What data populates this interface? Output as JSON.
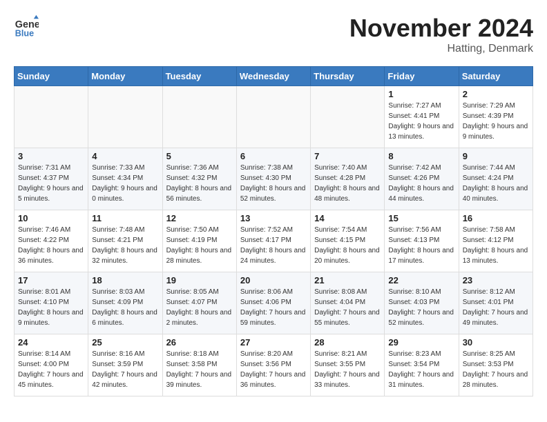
{
  "header": {
    "logo_line1": "General",
    "logo_line2": "Blue",
    "month": "November 2024",
    "location": "Hatting, Denmark"
  },
  "weekdays": [
    "Sunday",
    "Monday",
    "Tuesday",
    "Wednesday",
    "Thursday",
    "Friday",
    "Saturday"
  ],
  "weeks": [
    [
      {
        "day": "",
        "sunrise": "",
        "sunset": "",
        "daylight": ""
      },
      {
        "day": "",
        "sunrise": "",
        "sunset": "",
        "daylight": ""
      },
      {
        "day": "",
        "sunrise": "",
        "sunset": "",
        "daylight": ""
      },
      {
        "day": "",
        "sunrise": "",
        "sunset": "",
        "daylight": ""
      },
      {
        "day": "",
        "sunrise": "",
        "sunset": "",
        "daylight": ""
      },
      {
        "day": "1",
        "sunrise": "Sunrise: 7:27 AM",
        "sunset": "Sunset: 4:41 PM",
        "daylight": "Daylight: 9 hours and 13 minutes."
      },
      {
        "day": "2",
        "sunrise": "Sunrise: 7:29 AM",
        "sunset": "Sunset: 4:39 PM",
        "daylight": "Daylight: 9 hours and 9 minutes."
      }
    ],
    [
      {
        "day": "3",
        "sunrise": "Sunrise: 7:31 AM",
        "sunset": "Sunset: 4:37 PM",
        "daylight": "Daylight: 9 hours and 5 minutes."
      },
      {
        "day": "4",
        "sunrise": "Sunrise: 7:33 AM",
        "sunset": "Sunset: 4:34 PM",
        "daylight": "Daylight: 9 hours and 0 minutes."
      },
      {
        "day": "5",
        "sunrise": "Sunrise: 7:36 AM",
        "sunset": "Sunset: 4:32 PM",
        "daylight": "Daylight: 8 hours and 56 minutes."
      },
      {
        "day": "6",
        "sunrise": "Sunrise: 7:38 AM",
        "sunset": "Sunset: 4:30 PM",
        "daylight": "Daylight: 8 hours and 52 minutes."
      },
      {
        "day": "7",
        "sunrise": "Sunrise: 7:40 AM",
        "sunset": "Sunset: 4:28 PM",
        "daylight": "Daylight: 8 hours and 48 minutes."
      },
      {
        "day": "8",
        "sunrise": "Sunrise: 7:42 AM",
        "sunset": "Sunset: 4:26 PM",
        "daylight": "Daylight: 8 hours and 44 minutes."
      },
      {
        "day": "9",
        "sunrise": "Sunrise: 7:44 AM",
        "sunset": "Sunset: 4:24 PM",
        "daylight": "Daylight: 8 hours and 40 minutes."
      }
    ],
    [
      {
        "day": "10",
        "sunrise": "Sunrise: 7:46 AM",
        "sunset": "Sunset: 4:22 PM",
        "daylight": "Daylight: 8 hours and 36 minutes."
      },
      {
        "day": "11",
        "sunrise": "Sunrise: 7:48 AM",
        "sunset": "Sunset: 4:21 PM",
        "daylight": "Daylight: 8 hours and 32 minutes."
      },
      {
        "day": "12",
        "sunrise": "Sunrise: 7:50 AM",
        "sunset": "Sunset: 4:19 PM",
        "daylight": "Daylight: 8 hours and 28 minutes."
      },
      {
        "day": "13",
        "sunrise": "Sunrise: 7:52 AM",
        "sunset": "Sunset: 4:17 PM",
        "daylight": "Daylight: 8 hours and 24 minutes."
      },
      {
        "day": "14",
        "sunrise": "Sunrise: 7:54 AM",
        "sunset": "Sunset: 4:15 PM",
        "daylight": "Daylight: 8 hours and 20 minutes."
      },
      {
        "day": "15",
        "sunrise": "Sunrise: 7:56 AM",
        "sunset": "Sunset: 4:13 PM",
        "daylight": "Daylight: 8 hours and 17 minutes."
      },
      {
        "day": "16",
        "sunrise": "Sunrise: 7:58 AM",
        "sunset": "Sunset: 4:12 PM",
        "daylight": "Daylight: 8 hours and 13 minutes."
      }
    ],
    [
      {
        "day": "17",
        "sunrise": "Sunrise: 8:01 AM",
        "sunset": "Sunset: 4:10 PM",
        "daylight": "Daylight: 8 hours and 9 minutes."
      },
      {
        "day": "18",
        "sunrise": "Sunrise: 8:03 AM",
        "sunset": "Sunset: 4:09 PM",
        "daylight": "Daylight: 8 hours and 6 minutes."
      },
      {
        "day": "19",
        "sunrise": "Sunrise: 8:05 AM",
        "sunset": "Sunset: 4:07 PM",
        "daylight": "Daylight: 8 hours and 2 minutes."
      },
      {
        "day": "20",
        "sunrise": "Sunrise: 8:06 AM",
        "sunset": "Sunset: 4:06 PM",
        "daylight": "Daylight: 7 hours and 59 minutes."
      },
      {
        "day": "21",
        "sunrise": "Sunrise: 8:08 AM",
        "sunset": "Sunset: 4:04 PM",
        "daylight": "Daylight: 7 hours and 55 minutes."
      },
      {
        "day": "22",
        "sunrise": "Sunrise: 8:10 AM",
        "sunset": "Sunset: 4:03 PM",
        "daylight": "Daylight: 7 hours and 52 minutes."
      },
      {
        "day": "23",
        "sunrise": "Sunrise: 8:12 AM",
        "sunset": "Sunset: 4:01 PM",
        "daylight": "Daylight: 7 hours and 49 minutes."
      }
    ],
    [
      {
        "day": "24",
        "sunrise": "Sunrise: 8:14 AM",
        "sunset": "Sunset: 4:00 PM",
        "daylight": "Daylight: 7 hours and 45 minutes."
      },
      {
        "day": "25",
        "sunrise": "Sunrise: 8:16 AM",
        "sunset": "Sunset: 3:59 PM",
        "daylight": "Daylight: 7 hours and 42 minutes."
      },
      {
        "day": "26",
        "sunrise": "Sunrise: 8:18 AM",
        "sunset": "Sunset: 3:58 PM",
        "daylight": "Daylight: 7 hours and 39 minutes."
      },
      {
        "day": "27",
        "sunrise": "Sunrise: 8:20 AM",
        "sunset": "Sunset: 3:56 PM",
        "daylight": "Daylight: 7 hours and 36 minutes."
      },
      {
        "day": "28",
        "sunrise": "Sunrise: 8:21 AM",
        "sunset": "Sunset: 3:55 PM",
        "daylight": "Daylight: 7 hours and 33 minutes."
      },
      {
        "day": "29",
        "sunrise": "Sunrise: 8:23 AM",
        "sunset": "Sunset: 3:54 PM",
        "daylight": "Daylight: 7 hours and 31 minutes."
      },
      {
        "day": "30",
        "sunrise": "Sunrise: 8:25 AM",
        "sunset": "Sunset: 3:53 PM",
        "daylight": "Daylight: 7 hours and 28 minutes."
      }
    ]
  ]
}
